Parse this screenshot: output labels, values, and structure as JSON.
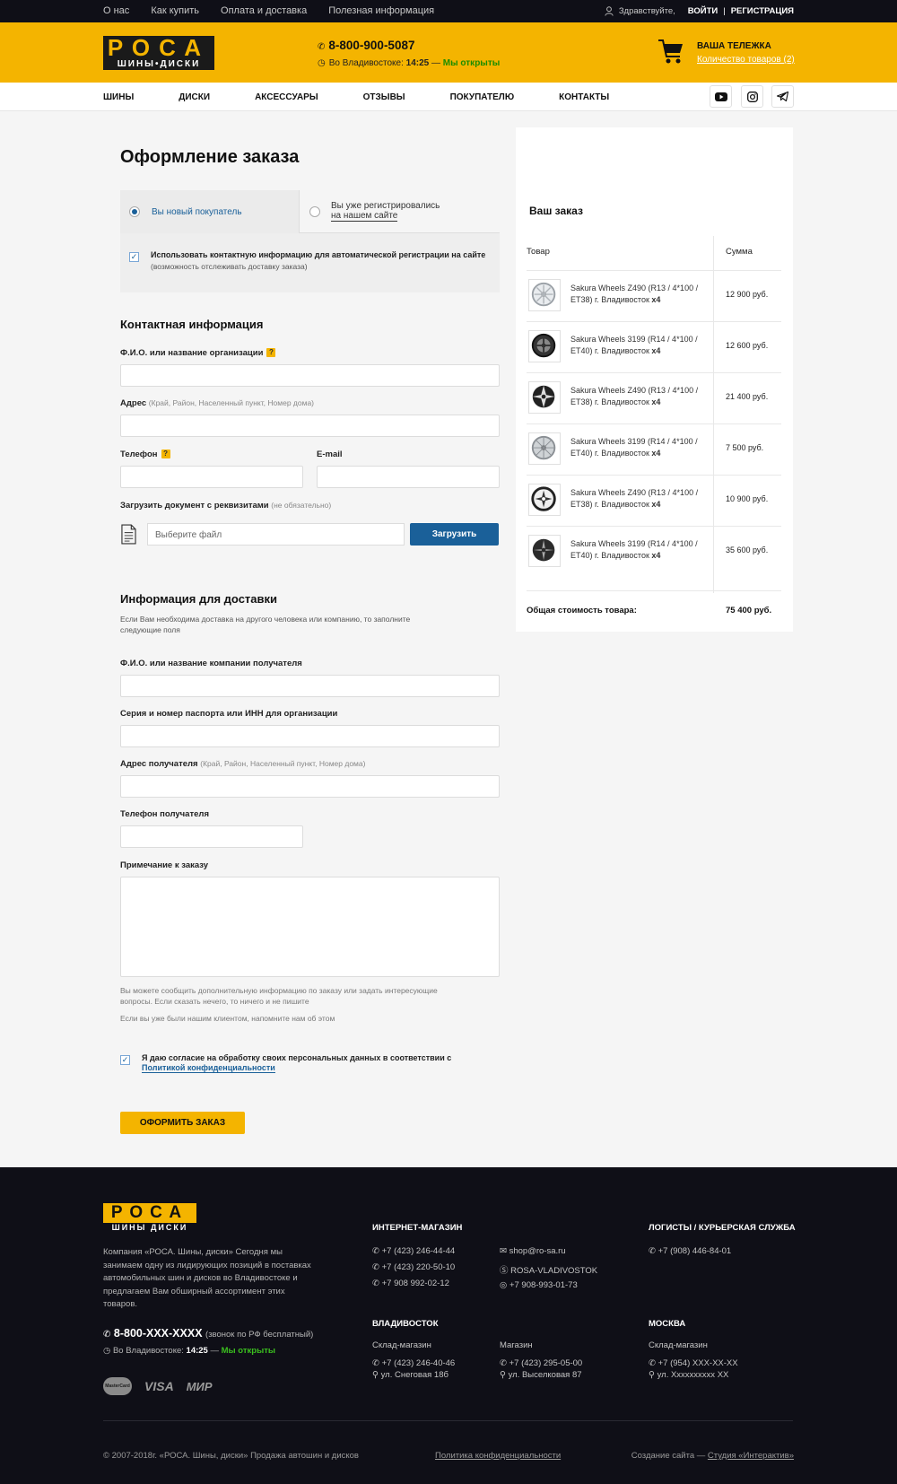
{
  "topbar": {
    "links": [
      "О нас",
      "Как купить",
      "Оплата и доставка",
      "Полезная информация"
    ],
    "greeting": "Здравствуйте,",
    "login": "ВОЙТИ",
    "separator": "|",
    "register": "РЕГИСТРАЦИЯ"
  },
  "header": {
    "logo_top": "РОСА",
    "logo_bottom": "ШИНЫ•ДИСКИ",
    "phone": "8-800-900-5087",
    "hours_prefix": "Во Владивостоке:",
    "time": "14:25",
    "dash": "—",
    "open_status": "Мы открыты",
    "cart_title": "ВАША ТЕЛЕЖКА",
    "cart_count": "Количество товаров (2)"
  },
  "nav": {
    "items": [
      "ШИНЫ",
      "ДИСКИ",
      "АКСЕССУАРЫ",
      "ОТЗЫВЫ",
      "ПОКУПАТЕЛЮ",
      "КОНТАКТЫ"
    ],
    "social": [
      "youtube-icon",
      "instagram-icon",
      "telegram-icon"
    ]
  },
  "checkout": {
    "title": "Оформление заказа",
    "tab_new": "Вы новый покупатель",
    "tab_registered_1": "Вы уже регистрировались",
    "tab_registered_2": "на нашем сайте",
    "use_contact": "Использовать контактную информацию для автоматической регистрации на сайте",
    "use_contact_hint": "(возможность отслеживать доставку заказа)",
    "contact_title": "Контактная информация",
    "name_label": "Ф.И.О. или название организации",
    "address_label": "Адрес",
    "address_hint": "(Край, Район, Населенный пункт, Номер дома)",
    "phone_label": "Телефон",
    "email_label": "E-mail",
    "upload_label": "Загрузить документ с реквизитами",
    "upload_hint": "(не обязательно)",
    "file_placeholder": "Выберите файл",
    "upload_button": "Загрузить",
    "delivery_title": "Информация для доставки",
    "delivery_note": "Если Вам необходима доставка на другого человека или компанию, то заполните следующие поля",
    "recipient_label": "Ф.И.О. или название компании получателя",
    "passport_label": "Серия и номер паспорта или ИНН для организации",
    "recipient_address_label": "Адрес получателя",
    "recipient_address_hint": "(Край, Район, Населенный пункт, Номер дома)",
    "recipient_phone_label": "Телефон получателя",
    "note_label": "Примечание к заказу",
    "note_help": "Вы можете сообщить дополнительную информацию по заказу или задать интересующие вопросы. Если сказать нечего, то ничего и не пишите",
    "note_help2": "Если вы уже были нашим клиентом, напомните нам об этом",
    "consent": "Я даю согласие на обработку своих персональных данных в соответствии с",
    "consent_link": "Политикой конфиденциальности",
    "submit": "ОФОРМИТЬ ЗАКАЗ"
  },
  "order": {
    "title": "Ваш заказ",
    "col_product": "Товар",
    "col_sum": "Сумма",
    "items": [
      {
        "name": "Sakura Wheels Z490 (R13 / 4*100 / ET38) г. Владивосток",
        "qty": "x4",
        "price": "12 900 руб."
      },
      {
        "name": "Sakura Wheels 3199 (R14 / 4*100 / ET40) г. Владивосток",
        "qty": "x4",
        "price": "12 600 руб."
      },
      {
        "name": "Sakura Wheels Z490 (R13 / 4*100 / ET38) г. Владивосток",
        "qty": "x4",
        "price": "21 400 руб."
      },
      {
        "name": "Sakura Wheels 3199 (R14 / 4*100 / ET40) г. Владивосток",
        "qty": "x4",
        "price": "7 500 руб."
      },
      {
        "name": "Sakura Wheels Z490 (R13 / 4*100 / ET38) г. Владивосток",
        "qty": "x4",
        "price": "10 900 руб."
      },
      {
        "name": "Sakura Wheels 3199 (R14 / 4*100 / ET40) г. Владивосток",
        "qty": "x4",
        "price": "35 600 руб."
      }
    ],
    "total_label": "Общая стоимость товара:",
    "total_value": "75 400 руб."
  },
  "footer": {
    "logo_top": "РОСА",
    "logo_bottom": "ШИНЫ ДИСКИ",
    "about": "Компания «РОСА. Шины, диски» Сегодня мы занимаем одну из лидирующих позиций в поставках автомобильных шин и дисков во Владивостоке и предлагаем Вам обширный ассортимент этих товаров.",
    "phone": "8-800-XXX-XXXX",
    "phone_note": "(звонок по РФ бесплатный)",
    "hours_prefix": "Во Владивостоке:",
    "time": "14:25",
    "dash": "—",
    "open_status": "Мы открыты",
    "payments": [
      "MasterCard",
      "VISA",
      "МИР"
    ],
    "shop_title": "ИНТЕРНЕТ-МАГАЗИН",
    "shop_phones": [
      "+7 (423) 246-44-44",
      "+7 (423) 220-50-10",
      "+7 908 992-02-12"
    ],
    "shop_email": "shop@ro-sa.ru",
    "shop_skype": "ROSA-VLADIVOSTOK",
    "shop_whatsapp": "+7 908-993-01-73",
    "logistics_title": "ЛОГИСТЫ / КУРЬЕРСКАЯ СЛУЖБА",
    "logistics_phone": "+7 (908) 446-84-01",
    "vl_title": "ВЛАДИВОСТОК",
    "vl_store1_title": "Склад-магазин",
    "vl_store1_phone": "+7 (423) 246-40-46",
    "vl_store1_addr": "ул. Снеговая 18б",
    "vl_store2_title": "Магазин",
    "vl_store2_phone": "+7 (423) 295-05-00",
    "vl_store2_addr": "ул. Выселковая 87",
    "msk_title": "МОСКВА",
    "msk_store_title": "Склад-магазин",
    "msk_store_phone": "+7 (954) XXX-XX-XX",
    "msk_store_addr": "ул. Xxxxxxxxxx XX",
    "copyright": "© 2007-2018г. «РОСА. Шины, диски» Продажа автошин и дисков",
    "privacy": "Политика конфиденциальности",
    "credit_prefix": "Создание сайта —",
    "credit_link": "Студия «Интерактив»"
  }
}
